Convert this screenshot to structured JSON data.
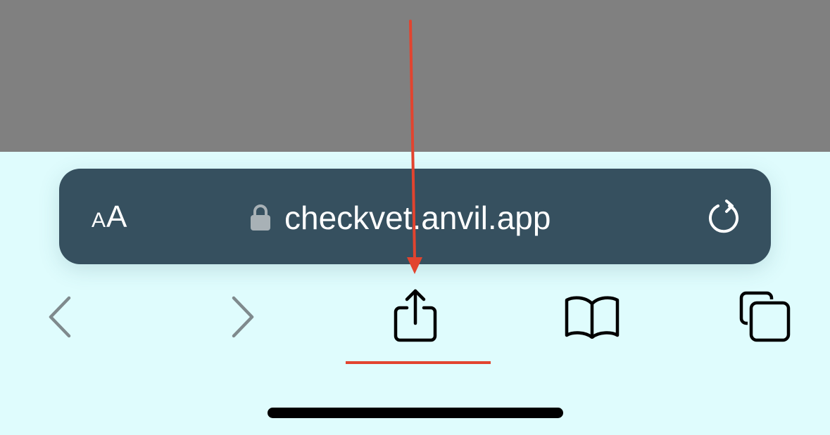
{
  "address_bar": {
    "text_size_small": "A",
    "text_size_large": "A",
    "url": "checkvet.anvil.app"
  },
  "icons": {
    "text_size": "text-size-icon",
    "lock": "lock-icon",
    "reload": "reload-icon",
    "back": "chevron-left-icon",
    "forward": "chevron-right-icon",
    "share": "share-icon",
    "bookmarks": "book-icon",
    "tabs": "tabs-icon"
  },
  "colors": {
    "top_area": "#808080",
    "background": "#dffcfd",
    "address_bar": "#36505f",
    "annotation": "#e2442f",
    "disabled_icon": "#7f8a8d",
    "active_icon": "#000000"
  },
  "toolbar": {
    "back_enabled": false,
    "forward_enabled": false
  },
  "annotation": {
    "target": "share-button"
  }
}
